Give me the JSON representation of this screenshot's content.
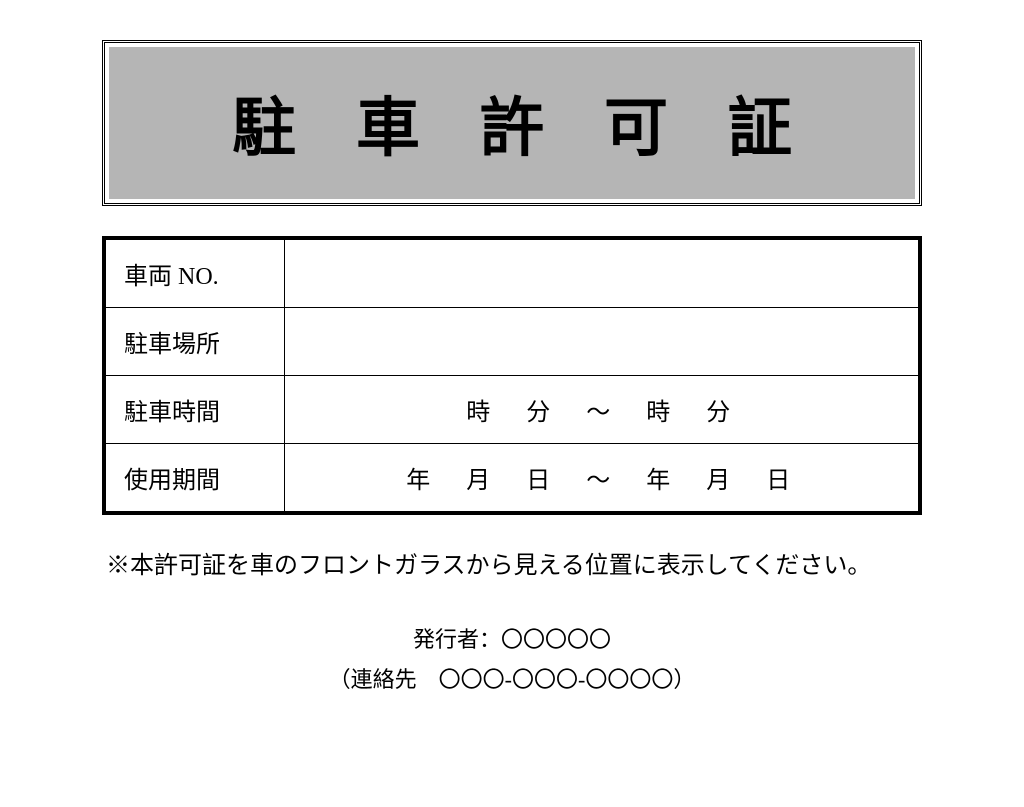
{
  "title": "駐車許可証",
  "table": {
    "rows": [
      {
        "label": "車両 NO.",
        "value": ""
      },
      {
        "label": "駐車場所",
        "value": ""
      },
      {
        "label": "駐車時間",
        "value": "時　分　〜　時　分"
      },
      {
        "label": "使用期間",
        "value": "年　月　日　〜　年　月　日"
      }
    ]
  },
  "notice": "※本許可証を車のフロントガラスから見える位置に表示してください。",
  "issuer": {
    "label": "発行者：",
    "name": "〇〇〇〇〇",
    "contact_label": "（連絡先　",
    "contact": "〇〇〇-〇〇〇-〇〇〇〇",
    "contact_close": "）"
  }
}
